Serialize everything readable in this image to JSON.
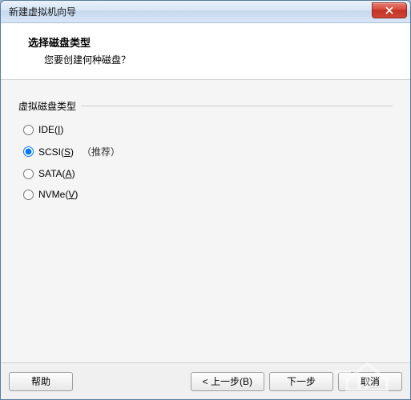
{
  "window": {
    "title": "新建虚拟机向导"
  },
  "header": {
    "title": "选择磁盘类型",
    "subtitle": "您要创建何种磁盘？"
  },
  "group": {
    "label": "虚拟磁盘类型",
    "options": {
      "ide": {
        "prefix": "IDE(",
        "key": "I",
        "suffix": ")"
      },
      "scsi": {
        "prefix": "SCSI(",
        "key": "S",
        "suffix": ")",
        "recommend": "（推荐）"
      },
      "sata": {
        "prefix": "SATA(",
        "key": "A",
        "suffix": ")"
      },
      "nvme": {
        "prefix": "NVMe(",
        "key": "V",
        "suffix": ")"
      }
    }
  },
  "footer": {
    "help": "帮助",
    "back": "< 上一步(B)",
    "next": "下一步",
    "cancel": "取消"
  }
}
